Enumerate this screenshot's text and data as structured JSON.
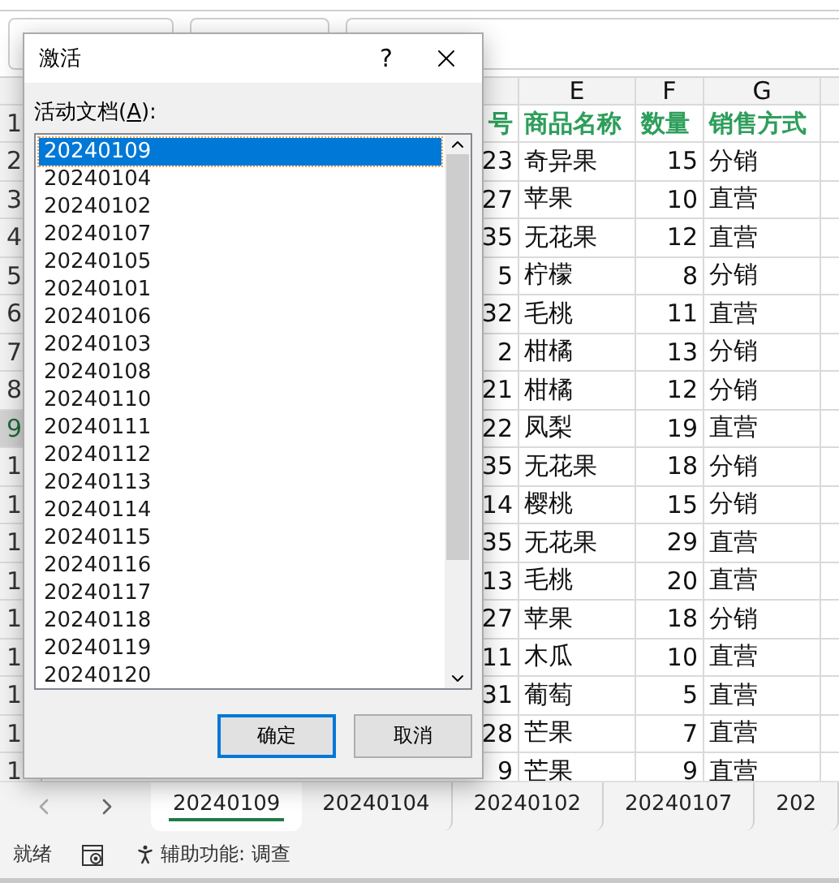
{
  "sheet": {
    "columns": [
      {
        "label": "E"
      },
      {
        "label": "F"
      },
      {
        "label": "G"
      }
    ],
    "header_row": {
      "row": "1",
      "d": "号",
      "e": "商品名称",
      "f": "数量",
      "g": "销售方式"
    },
    "rows": [
      {
        "row": "2",
        "d": "23",
        "e": "奇异果",
        "f": "15",
        "g": "分销",
        "selected": false
      },
      {
        "row": "3",
        "d": "27",
        "e": "苹果",
        "f": "10",
        "g": "直营",
        "selected": false
      },
      {
        "row": "4",
        "d": "35",
        "e": "无花果",
        "f": "12",
        "g": "直营",
        "selected": false
      },
      {
        "row": "5",
        "d": "5",
        "e": "柠檬",
        "f": "8",
        "g": "分销",
        "selected": false
      },
      {
        "row": "6",
        "d": "32",
        "e": "毛桃",
        "f": "11",
        "g": "直营",
        "selected": false
      },
      {
        "row": "7",
        "d": "2",
        "e": "柑橘",
        "f": "13",
        "g": "分销",
        "selected": false
      },
      {
        "row": "8",
        "d": "21",
        "e": "柑橘",
        "f": "12",
        "g": "分销",
        "selected": false
      },
      {
        "row": "9",
        "d": "22",
        "e": "凤梨",
        "f": "19",
        "g": "直营",
        "selected": true
      },
      {
        "row": "1",
        "d": "35",
        "e": "无花果",
        "f": "18",
        "g": "分销",
        "selected": false
      },
      {
        "row": "1",
        "d": "14",
        "e": "樱桃",
        "f": "15",
        "g": "分销",
        "selected": false
      },
      {
        "row": "1",
        "d": "35",
        "e": "无花果",
        "f": "29",
        "g": "直营",
        "selected": false
      },
      {
        "row": "1",
        "d": "13",
        "e": "毛桃",
        "f": "20",
        "g": "直营",
        "selected": false
      },
      {
        "row": "1",
        "d": "27",
        "e": "苹果",
        "f": "18",
        "g": "分销",
        "selected": false
      },
      {
        "row": "1",
        "d": "11",
        "e": "木瓜",
        "f": "10",
        "g": "直营",
        "selected": false
      },
      {
        "row": "1",
        "d": "31",
        "e": "葡萄",
        "f": "5",
        "g": "直营",
        "selected": false
      },
      {
        "row": "1",
        "d": "28",
        "e": "芒果",
        "f": "7",
        "g": "直营",
        "selected": false
      },
      {
        "row": "1",
        "d": "9",
        "e": "芒果",
        "f": "9",
        "g": "直营",
        "selected": false
      }
    ]
  },
  "dialog": {
    "title": "激活",
    "help": "?",
    "list_label": {
      "before": "活动文档(",
      "key": "A",
      "after": "):"
    },
    "items": [
      {
        "label": "20240109",
        "selected": true
      },
      {
        "label": "20240104",
        "selected": false
      },
      {
        "label": "20240102",
        "selected": false
      },
      {
        "label": "20240107",
        "selected": false
      },
      {
        "label": "20240105",
        "selected": false
      },
      {
        "label": "20240101",
        "selected": false
      },
      {
        "label": "20240106",
        "selected": false
      },
      {
        "label": "20240103",
        "selected": false
      },
      {
        "label": "20240108",
        "selected": false
      },
      {
        "label": "20240110",
        "selected": false
      },
      {
        "label": "20240111",
        "selected": false
      },
      {
        "label": "20240112",
        "selected": false
      },
      {
        "label": "20240113",
        "selected": false
      },
      {
        "label": "20240114",
        "selected": false
      },
      {
        "label": "20240115",
        "selected": false
      },
      {
        "label": "20240116",
        "selected": false
      },
      {
        "label": "20240117",
        "selected": false
      },
      {
        "label": "20240118",
        "selected": false
      },
      {
        "label": "20240119",
        "selected": false
      },
      {
        "label": "20240120",
        "selected": false
      }
    ],
    "buttons": [
      {
        "label": "确定",
        "default": true
      },
      {
        "label": "取消",
        "default": false
      }
    ]
  },
  "tabs": [
    {
      "label": "20240109",
      "selected": true
    },
    {
      "label": "20240104",
      "selected": false
    },
    {
      "label": "20240102",
      "selected": false
    },
    {
      "label": "20240107",
      "selected": false
    },
    {
      "label": "202",
      "selected": false
    }
  ],
  "status_bar": {
    "ready": "就绪",
    "accessibility": "辅助功能: 调查"
  }
}
